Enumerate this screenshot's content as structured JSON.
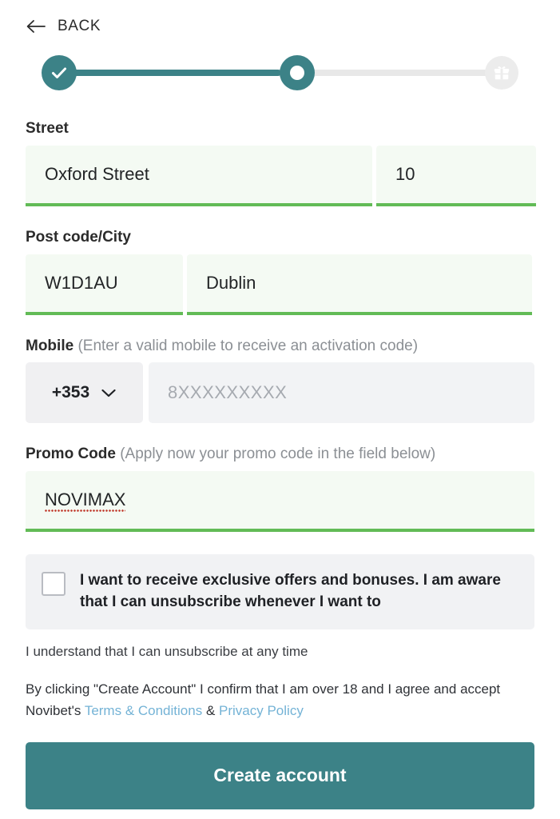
{
  "header": {
    "back_label": "BACK",
    "back_icon": "arrow-left-icon"
  },
  "stepper": {
    "steps": [
      {
        "state": "completed",
        "icon": "check-icon"
      },
      {
        "state": "current",
        "icon": "dot-icon"
      },
      {
        "state": "upcoming",
        "icon": "gift-icon"
      }
    ],
    "active_color": "#3c8287",
    "inactive_color": "#e8e8e8"
  },
  "form": {
    "street": {
      "label": "Street",
      "value": "Oxford Street",
      "number_value": "10"
    },
    "postcode_city": {
      "label": "Post code/City",
      "postcode_value": "W1D1AU",
      "city_value": "Dublin"
    },
    "mobile": {
      "label": "Mobile",
      "hint": "(Enter a valid mobile to receive an activation code)",
      "country_code": "+353",
      "placeholder": "8XXXXXXXXX",
      "value": ""
    },
    "promo": {
      "label": "Promo Code",
      "hint": "(Apply now your promo code in the field below)",
      "value": "NOVIMAX"
    }
  },
  "consent": {
    "checkbox_label": "I want to receive exclusive offers and bonuses. I am aware that I can unsubscribe whenever I want to",
    "checked": false,
    "subnote": "I understand that I can unsubscribe at any time"
  },
  "terms": {
    "line1": "By clicking \"Create Account\" I confirm that I am over 18 and I agree and accept",
    "brand_prefix": "Novibet's",
    "terms_link": "Terms & Conditions",
    "separator": "&",
    "privacy_link": "Privacy Policy",
    "link_color": "#74b3d6"
  },
  "cta": {
    "label": "Create account",
    "color": "#3c8287"
  },
  "colors": {
    "valid_underline": "#62bb56",
    "valid_field_bg": "#f4faf3",
    "neutral_field_bg": "#f2f3f5"
  }
}
